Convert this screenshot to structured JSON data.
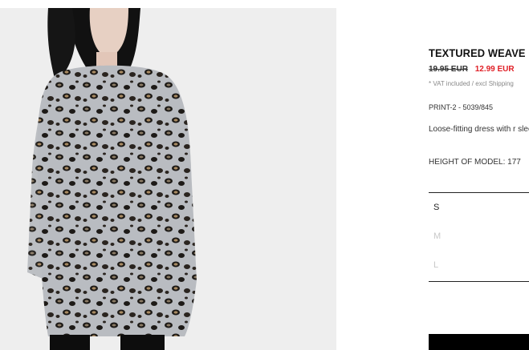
{
  "product": {
    "title": "TEXTURED WEAVE",
    "price_old": "19.95 EUR",
    "price_new": "12.99 EUR",
    "vat_note": "* VAT included / excl Shipping",
    "reference": "PRINT-2 - 5039/845",
    "description": "Loose-fitting dress with r sleeves.",
    "model_height": "HEIGHT OF MODEL: 177"
  },
  "sizes": [
    {
      "label": "S",
      "available": true
    },
    {
      "label": "M",
      "available": false
    },
    {
      "label": "L",
      "available": false
    }
  ],
  "colors": {
    "sale_price": "#e01f26",
    "button": "#000000"
  }
}
